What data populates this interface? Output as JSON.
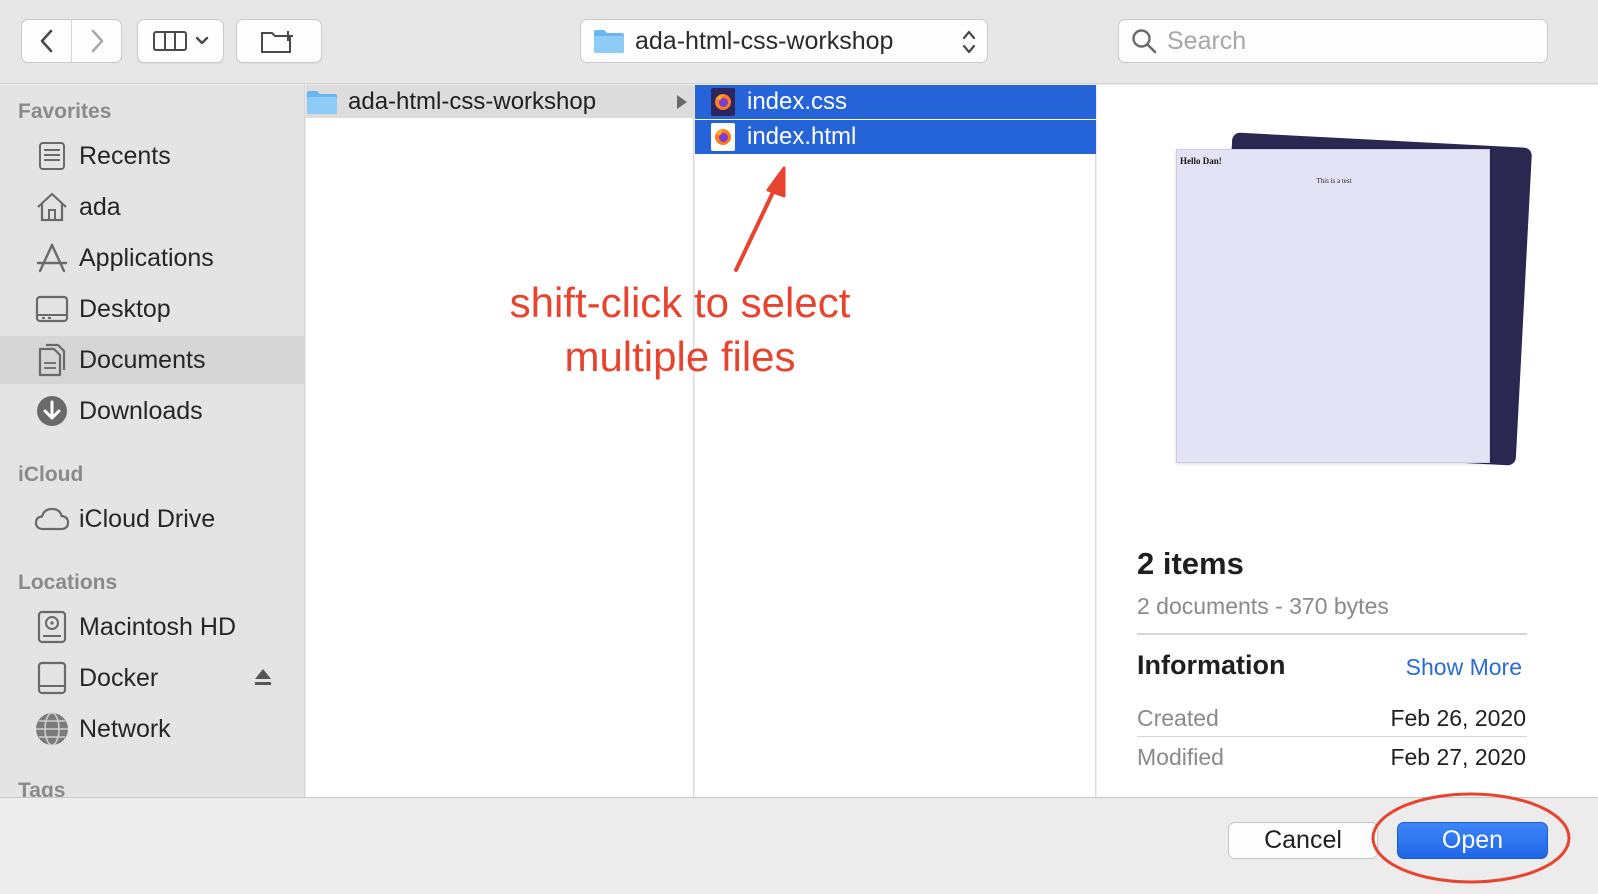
{
  "toolbar": {
    "path_label": "ada-html-css-workshop",
    "search_placeholder": "Search"
  },
  "sidebar": {
    "favorites_header": "Favorites",
    "favorites": [
      {
        "label": "Recents",
        "icon": "recents-icon"
      },
      {
        "label": "ada",
        "icon": "home-icon"
      },
      {
        "label": "Applications",
        "icon": "applications-icon"
      },
      {
        "label": "Desktop",
        "icon": "desktop-icon"
      },
      {
        "label": "Documents",
        "icon": "documents-icon",
        "selected": true
      },
      {
        "label": "Downloads",
        "icon": "downloads-icon"
      }
    ],
    "icloud_header": "iCloud",
    "icloud": [
      {
        "label": "iCloud Drive",
        "icon": "cloud-icon"
      }
    ],
    "locations_header": "Locations",
    "locations": [
      {
        "label": "Macintosh HD",
        "icon": "disk-icon"
      },
      {
        "label": "Docker",
        "icon": "external-disk-icon"
      },
      {
        "label": "Network",
        "icon": "network-icon"
      }
    ],
    "tags_header": "Tags"
  },
  "columns": {
    "folder": "ada-html-css-workshop",
    "files": [
      {
        "name": "index.css",
        "icon": "firefox-css-icon",
        "selected": true
      },
      {
        "name": "index.html",
        "icon": "firefox-html-icon",
        "selected": true
      }
    ]
  },
  "preview": {
    "doc_heading": "Hello Dan!",
    "doc_text": "This is a test",
    "count": "2 items",
    "summary": "2 documents - 370 bytes",
    "info_header": "Information",
    "show_more": "Show More",
    "created_label": "Created",
    "created_value": "Feb 26, 2020",
    "modified_label": "Modified",
    "modified_value": "Feb 27, 2020"
  },
  "buttons": {
    "cancel": "Cancel",
    "open": "Open"
  },
  "annotation": {
    "line1": "shift-click to select",
    "line2": "multiple files",
    "color": "#e8432e"
  },
  "colors": {
    "selection": "#2563d9",
    "accent": "#2a6ad9"
  }
}
